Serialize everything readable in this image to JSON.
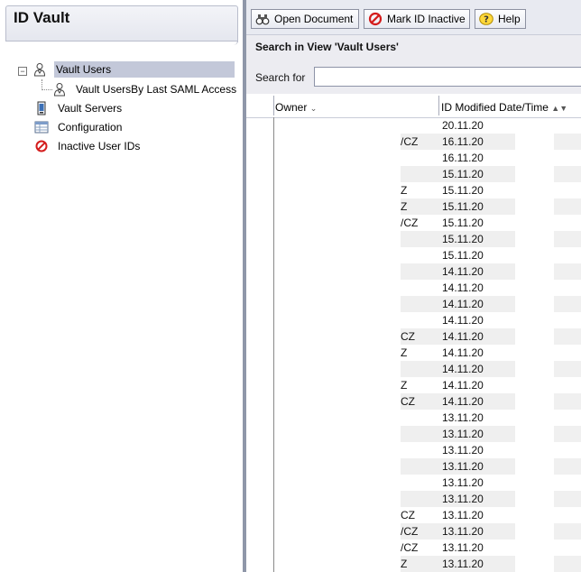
{
  "navigator": {
    "title": "ID Vault",
    "items": [
      {
        "label": "Vault Users",
        "icon": "user-icon",
        "selected": true
      },
      {
        "label": "Vault UsersBy Last SAML Access",
        "icon": "user-icon"
      },
      {
        "label": "Vault Servers",
        "icon": "server-icon"
      },
      {
        "label": "Configuration",
        "icon": "configuration-icon"
      },
      {
        "label": "Inactive User IDs",
        "icon": "prohibited-icon"
      }
    ]
  },
  "toolbar": {
    "open_document": "Open Document",
    "mark_inactive": "Mark ID Inactive",
    "help": "Help"
  },
  "search": {
    "title": "Search in View 'Vault Users'",
    "label": "Search for",
    "value": ""
  },
  "grid": {
    "columns": [
      "Owner",
      "ID Modified Date/Time"
    ],
    "rows": [
      {
        "owner": "",
        "date": "20.11.20"
      },
      {
        "owner": "/CZ",
        "date": "16.11.20"
      },
      {
        "owner": "",
        "date": "16.11.20"
      },
      {
        "owner": "",
        "date": "15.11.20"
      },
      {
        "owner": "Z",
        "date": "15.11.20"
      },
      {
        "owner": "Z",
        "date": "15.11.20"
      },
      {
        "owner": "/CZ",
        "date": "15.11.20"
      },
      {
        "owner": "",
        "date": "15.11.20"
      },
      {
        "owner": "",
        "date": "15.11.20"
      },
      {
        "owner": "",
        "date": "14.11.20"
      },
      {
        "owner": "",
        "date": "14.11.20"
      },
      {
        "owner": "",
        "date": "14.11.20"
      },
      {
        "owner": "",
        "date": "14.11.20"
      },
      {
        "owner": "CZ",
        "date": "14.11.20"
      },
      {
        "owner": "Z",
        "date": "14.11.20"
      },
      {
        "owner": "",
        "date": "14.11.20"
      },
      {
        "owner": "Z",
        "date": "14.11.20"
      },
      {
        "owner": "CZ",
        "date": "14.11.20"
      },
      {
        "owner": "",
        "date": "13.11.20"
      },
      {
        "owner": "",
        "date": "13.11.20"
      },
      {
        "owner": "",
        "date": "13.11.20"
      },
      {
        "owner": "",
        "date": "13.11.20"
      },
      {
        "owner": "",
        "date": "13.11.20"
      },
      {
        "owner": "",
        "date": "13.11.20"
      },
      {
        "owner": "CZ",
        "date": "13.11.20"
      },
      {
        "owner": "/CZ",
        "date": "13.11.20"
      },
      {
        "owner": "/CZ",
        "date": "13.11.20"
      },
      {
        "owner": "Z",
        "date": "13.11.20"
      },
      {
        "owner": "",
        "date": "13.11.20"
      }
    ]
  },
  "colors": {
    "selection": "#c3c8d9",
    "splitter": "#8f97a9",
    "toolbar": "#e8eaf1"
  }
}
